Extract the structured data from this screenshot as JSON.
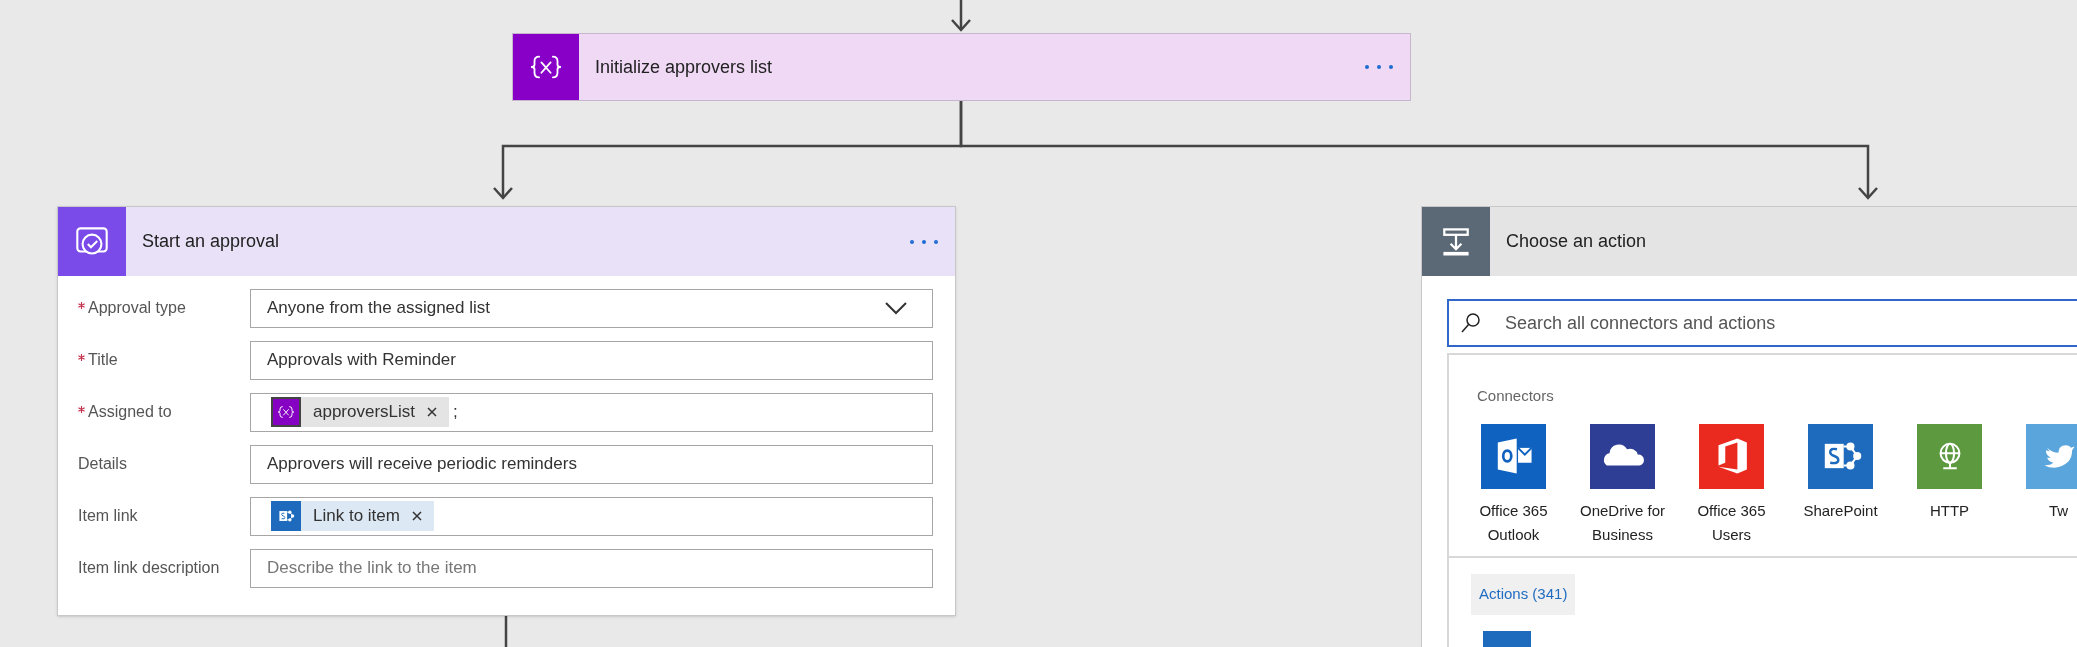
{
  "variable_card": {
    "title": "Initialize approvers list"
  },
  "approval_card": {
    "title": "Start an approval",
    "fields": [
      {
        "label": "Approval type",
        "required": true,
        "kind": "dropdown",
        "value": "Anyone from the assigned list"
      },
      {
        "label": "Title",
        "required": true,
        "kind": "text",
        "value": "Approvals with Reminder"
      },
      {
        "label": "Assigned to",
        "required": true,
        "kind": "token",
        "token": {
          "text": "approversList",
          "kind": "variable"
        },
        "suffix": ";"
      },
      {
        "label": "Details",
        "required": false,
        "kind": "text",
        "value": "Approvers will receive periodic reminders"
      },
      {
        "label": "Item link",
        "required": false,
        "kind": "token",
        "token": {
          "text": "Link to item",
          "kind": "sharepoint"
        }
      },
      {
        "label": "Item link description",
        "required": false,
        "kind": "placeholder",
        "placeholder": "Describe the link to the item"
      }
    ]
  },
  "action_card": {
    "title": "Choose an action",
    "search": {
      "placeholder": "Search all connectors and actions"
    },
    "connectors_heading": "Connectors",
    "connectors": [
      {
        "label": "Office 365 Outlook",
        "kind": "outlook",
        "color": "#0f62c0"
      },
      {
        "label": "OneDrive for Business",
        "kind": "onedrive",
        "color": "#2d3e94"
      },
      {
        "label": "Office 365 Users",
        "kind": "office",
        "color": "#eb2a1f"
      },
      {
        "label": "SharePoint",
        "kind": "sharepoint",
        "color": "#1e6bbd"
      },
      {
        "label": "HTTP",
        "kind": "http",
        "color": "#5d9a3f"
      },
      {
        "label": "Tw",
        "kind": "twitter",
        "color": "#5aa5dc"
      }
    ],
    "actions_tab": "Actions (341)"
  }
}
